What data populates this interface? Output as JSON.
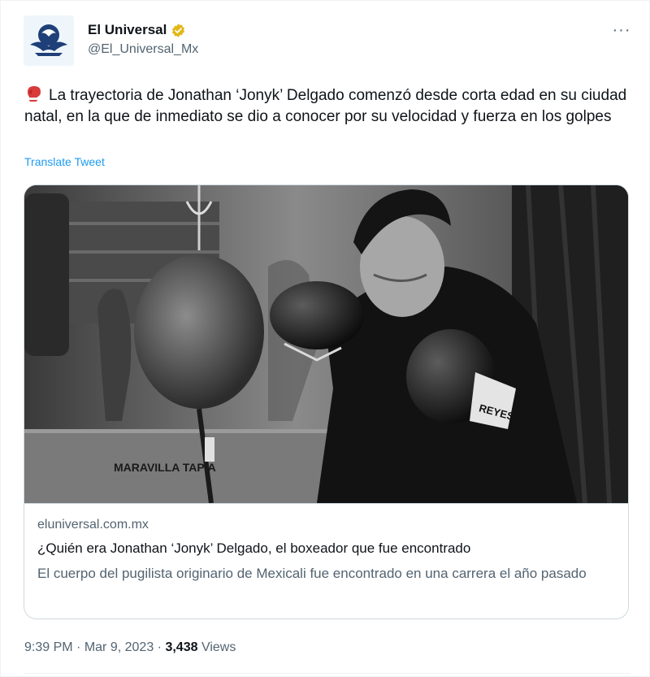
{
  "author": {
    "display_name": "El Universal",
    "handle": "@El_Universal_Mx",
    "verified_icon": "verified-badge-gold",
    "badge_color": "#e2b719"
  },
  "more_label": "···",
  "tweet": {
    "emoji": "boxing-glove-emoji",
    "text": "La trayectoria de Jonathan ‘Jonyk’ Delgado comenzó desde corta edad en su ciudad natal, en la que de inmediato se dio a conocer por su velocidad y fuerza en los golpes",
    "translate_label": "Translate Tweet"
  },
  "card": {
    "image_texts": {
      "wall_sign": "MARAVILLA TAPIA",
      "glove_brand": "REYES"
    },
    "domain": "eluniversal.com.mx",
    "title": "¿Quién era Jonathan ‘Jonyk’ Delgado, el boxeador que fue encontrado",
    "description": "El cuerpo del pugilista originario de Mexicali fue encontrado en una carrera el año pasado"
  },
  "meta": {
    "time": "9:39 PM",
    "separator": "·",
    "date": "Mar 9, 2023",
    "views_count": "3,438",
    "views_label": "Views"
  },
  "colors": {
    "link": "#1d9bf0",
    "secondary_text": "#536471",
    "primary_text": "#0f1419",
    "border": "#cfd9de"
  }
}
